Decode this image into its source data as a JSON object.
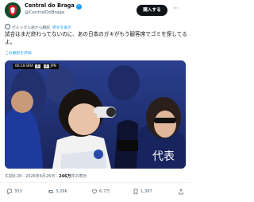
{
  "header": {
    "display_name": "Central do Braga",
    "handle": "@CentralDoBraga",
    "follow_label": "購入する",
    "more_label": "···"
  },
  "translation": {
    "notice": "ポルトガル語から翻訳",
    "original_link": "原文を表示"
  },
  "tweet": {
    "text": "試合はまだ終わってないのに、あの日本のガキがもう観客席でゴミを探してるよ。",
    "rate_translation": "この翻訳を評価"
  },
  "media": {
    "scoreboard": {
      "time": "66:18",
      "team_left": "BRA",
      "score_left": "1",
      "score_right": "1",
      "team_right": "JPN"
    }
  },
  "meta": {
    "time": "午前9:28",
    "date": "2026年6月26日",
    "views_count": "246万",
    "views_label": "件の表示"
  },
  "actions": {
    "reply_count": "353",
    "retweet_count": "3,29K",
    "like_count": "6.7万",
    "bookmark_count": "1,367"
  },
  "colors": {
    "accent": "#1d9bf0",
    "follow_bg": "#0f1419",
    "secondary_text": "#536471"
  }
}
